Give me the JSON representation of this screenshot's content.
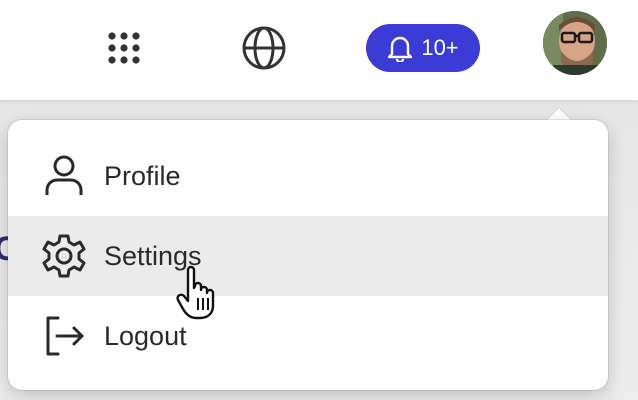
{
  "header": {
    "notifications": {
      "count_label": "10+"
    }
  },
  "menu": {
    "items": [
      {
        "label": "Profile",
        "icon": "user-icon"
      },
      {
        "label": "Settings",
        "icon": "gear-icon"
      },
      {
        "label": "Logout",
        "icon": "logout-icon"
      }
    ]
  },
  "colors": {
    "accent": "#3b3bd6",
    "menu_hover": "#ebebeb",
    "text": "#2a2a2a"
  }
}
